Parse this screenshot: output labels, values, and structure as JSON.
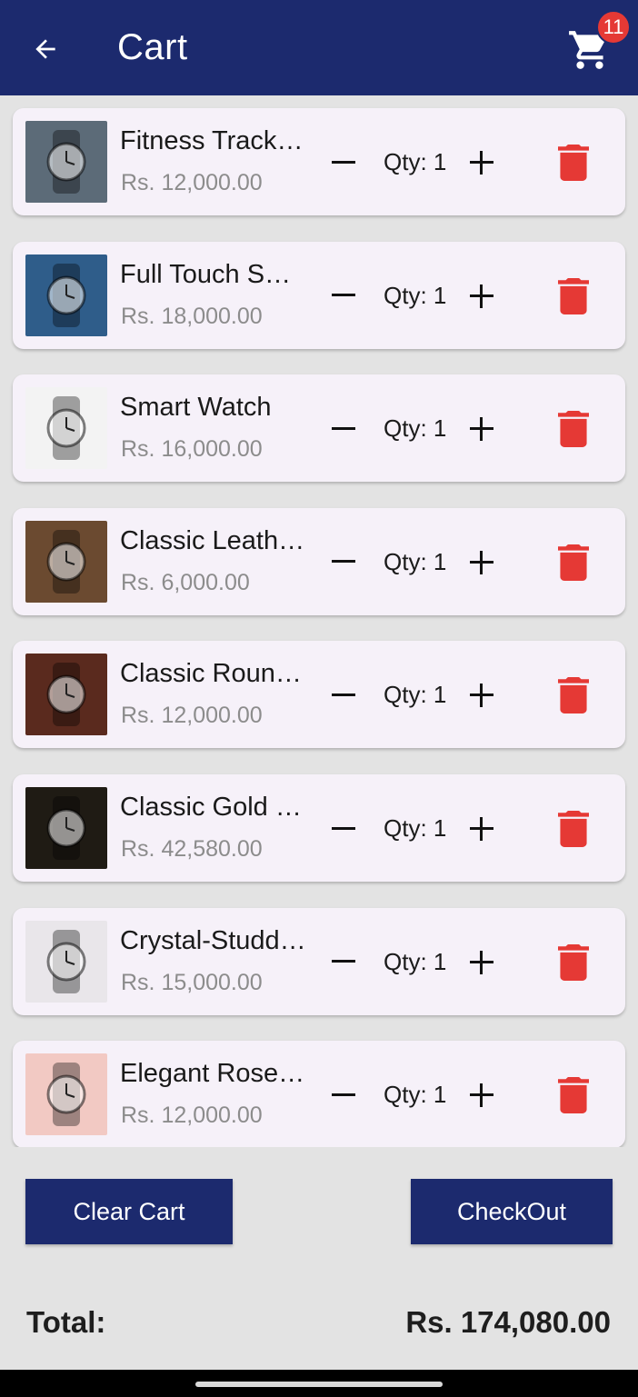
{
  "appbar": {
    "title": "Cart",
    "cart_count": "11",
    "colors": {
      "primary": "#1c2a6e",
      "badge": "#e53935"
    }
  },
  "items": [
    {
      "name": "Fitness Tracker Smartwatch",
      "price": "Rs. 12,000.00",
      "qty": "Qty: 1",
      "thumb_bg": "#5c6b78"
    },
    {
      "name": "Full Touch Smartwatch",
      "price": "Rs. 18,000.00",
      "qty": "Qty: 1",
      "thumb_bg": "#2f5d8a"
    },
    {
      "name": "Smart Watch",
      "price": "Rs. 16,000.00",
      "qty": "Qty: 1",
      "thumb_bg": "#f3f3f3"
    },
    {
      "name": "Classic Leather Watch",
      "price": "Rs. 6,000.00",
      "qty": "Qty: 1",
      "thumb_bg": "#6b4a30"
    },
    {
      "name": "Classic Round Watch",
      "price": "Rs. 12,000.00",
      "qty": "Qty: 1",
      "thumb_bg": "#5a2a1e"
    },
    {
      "name": "Classic Gold Watch",
      "price": "Rs. 42,580.00",
      "qty": "Qty: 1",
      "thumb_bg": "#1f1b14"
    },
    {
      "name": "Crystal-Studded Watch",
      "price": "Rs. 15,000.00",
      "qty": "Qty: 1",
      "thumb_bg": "#e9e6ea"
    },
    {
      "name": "Elegant Rose Watch Set",
      "price": "Rs. 12,000.00",
      "qty": "Qty: 1",
      "thumb_bg": "#f2c9c3"
    }
  ],
  "actions": {
    "clear_label": "Clear Cart",
    "checkout_label": "CheckOut"
  },
  "total": {
    "label": "Total:",
    "value": "Rs. 174,080.00"
  },
  "icons": {
    "back": "arrow-left-icon",
    "cart": "shopping-cart-icon",
    "decrease": "minus-icon",
    "increase": "plus-icon",
    "delete": "trash-icon"
  },
  "delete_color": "#e53935"
}
